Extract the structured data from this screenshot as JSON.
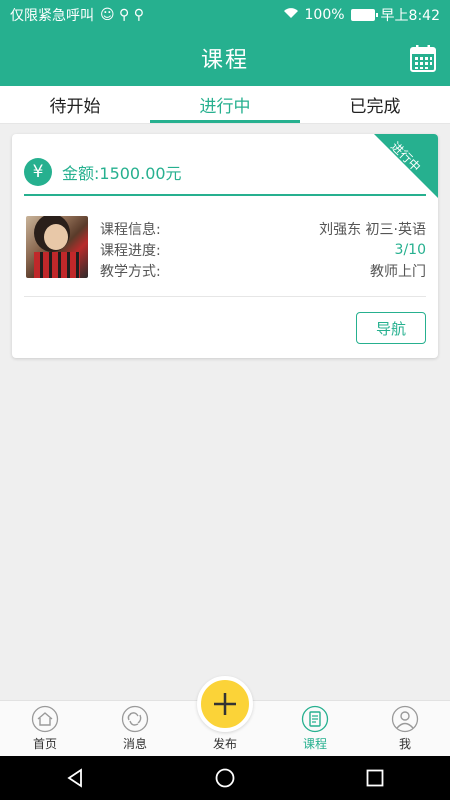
{
  "status_bar": {
    "carrier": "仅限紧急呼叫",
    "battery": "100%",
    "time": "早上8:42"
  },
  "header": {
    "title": "课程",
    "right_icon": "calendar-icon"
  },
  "tabs": [
    {
      "label": "待开始",
      "active": false
    },
    {
      "label": "进行中",
      "active": true
    },
    {
      "label": "已完成",
      "active": false
    }
  ],
  "course_card": {
    "amount_icon": "¥",
    "amount": "金额:1500.00元",
    "status_ribbon": "进行中",
    "rows": [
      {
        "label": "课程信息:",
        "value": "刘强东 初三·英语"
      },
      {
        "label": "课程进度:",
        "value": "3/10"
      },
      {
        "label": "教学方式:",
        "value": "教师上门"
      }
    ],
    "nav_button": "导航"
  },
  "bottom_nav": {
    "items": [
      {
        "label": "首页",
        "icon": "home-icon"
      },
      {
        "label": "消息",
        "icon": "message-icon"
      },
      {
        "label": "发布",
        "icon": "plus-icon"
      },
      {
        "label": "课程",
        "icon": "course-icon",
        "active": true
      },
      {
        "label": "我",
        "icon": "profile-icon"
      }
    ]
  },
  "colors": {
    "accent": "#26b08f",
    "publish": "#fbd338"
  }
}
